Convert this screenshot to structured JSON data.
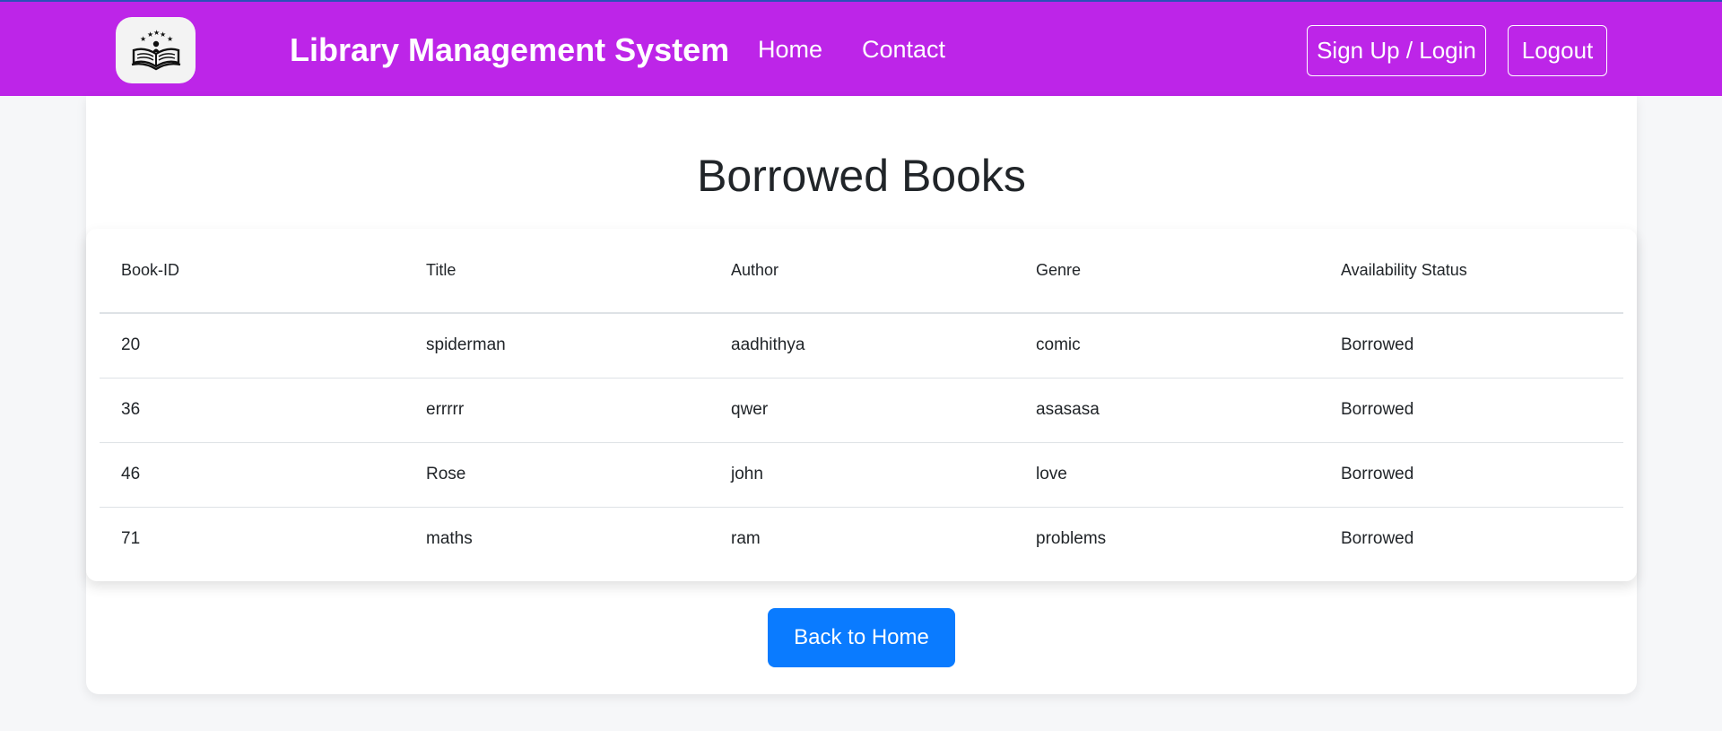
{
  "navbar": {
    "brand": "Library Management System",
    "links": [
      "Home",
      "Contact"
    ],
    "signup_label": "Sign Up / Login",
    "logout_label": "Logout",
    "background": "#bd25e8"
  },
  "main": {
    "title": "Borrowed Books",
    "table": {
      "headers": [
        "Book-ID",
        "Title",
        "Author",
        "Genre",
        "Availability Status"
      ],
      "rows": [
        [
          "20",
          "spiderman",
          "aadhithya",
          "comic",
          "Borrowed"
        ],
        [
          "36",
          "errrrr",
          "qwer",
          "asasasa",
          "Borrowed"
        ],
        [
          "46",
          "Rose",
          "john",
          "love",
          "Borrowed"
        ],
        [
          "71",
          "maths",
          "ram",
          "problems",
          "Borrowed"
        ]
      ]
    },
    "back_label": "Back to Home"
  },
  "colors": {
    "accent": "#0a7bff",
    "nav": "#bd25e8"
  }
}
